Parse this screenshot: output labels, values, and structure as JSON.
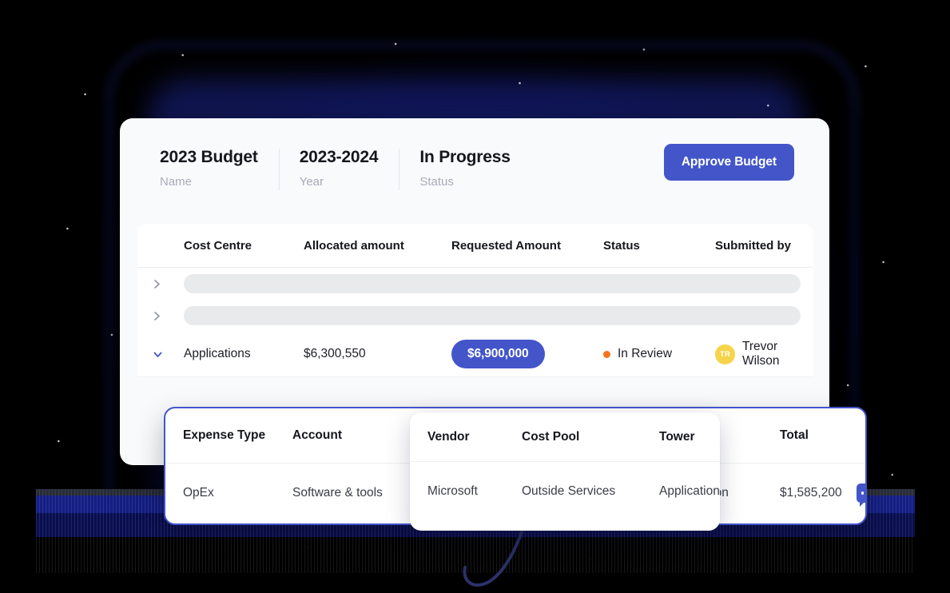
{
  "header": {
    "metas": [
      {
        "value": "2023 Budget",
        "label": "Name"
      },
      {
        "value": "2023-2024",
        "label": "Year"
      },
      {
        "value": "In Progress",
        "label": "Status"
      }
    ],
    "approve_label": "Approve Budget"
  },
  "table": {
    "columns": [
      "Cost Centre",
      "Allocated amount",
      "Requested Amount",
      "Status",
      "Submitted by"
    ],
    "skeleton_rows": 2,
    "row": {
      "cost_centre": "Applications",
      "allocated_amount": "$6,300,550",
      "requested_amount": "$6,900,000",
      "status": "In Review",
      "status_dot_color": "#f5741f",
      "submitted_by": "Trevor Wilson",
      "avatar_initials": "TR",
      "avatar_color": "#f6d44a"
    }
  },
  "detail": {
    "columns": [
      "Expense Type",
      "Account",
      "Vendor",
      "Cost Pool",
      "Tower",
      "Total"
    ],
    "row": {
      "expense_type": "OpEx",
      "account": "Software & tools",
      "vendor": "Microsoft",
      "cost_pool": "Outside Services",
      "tower": "Application",
      "total": "$1,585,200"
    },
    "border_color": "#4355c9"
  },
  "floating_panel": {
    "columns": [
      "Vendor",
      "Cost Pool",
      "Tower"
    ],
    "row": {
      "vendor": "Microsoft",
      "cost_pool": "Outside Services",
      "tower": "Application"
    }
  },
  "theme": {
    "accent": "#4355c9",
    "card_bg": "#f9fafc",
    "page_bg": "#000000"
  }
}
